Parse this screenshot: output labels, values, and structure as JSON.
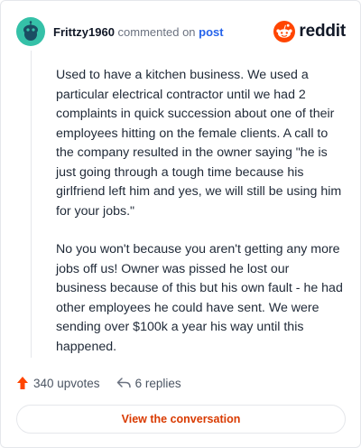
{
  "comment": {
    "username": "Frittzy1960",
    "commented_on": "commented on",
    "post_link": "post",
    "paragraphs": [
      "Used to have a kitchen business. We used a particular electrical contractor until we had 2 complaints in quick succession about one of their employees hitting on the female clients. A call to the company resulted in the owner saying \"he is just going through a tough time because his girlfriend left him and yes, we will still be using him for your jobs.\"",
      "No you won't because you aren't getting any more jobs off us! Owner was pissed he lost our business because of this but his own fault - he had other employees he could have sent. We were sending over $100k a year his way until this happened."
    ]
  },
  "brand": {
    "name": "reddit",
    "color": "#ff4500"
  },
  "stats": {
    "upvotes": "340 upvotes",
    "replies": "6 replies"
  },
  "actions": {
    "view_conversation": "View the conversation"
  },
  "colors": {
    "avatar": "#35c1a8",
    "accent": "#d93a00",
    "link": "#2563eb"
  },
  "icons": {
    "avatar": "snoo-avatar-icon",
    "brand": "reddit-logo-icon",
    "upvote": "upvote-arrow-icon",
    "reply": "reply-arrow-icon"
  }
}
